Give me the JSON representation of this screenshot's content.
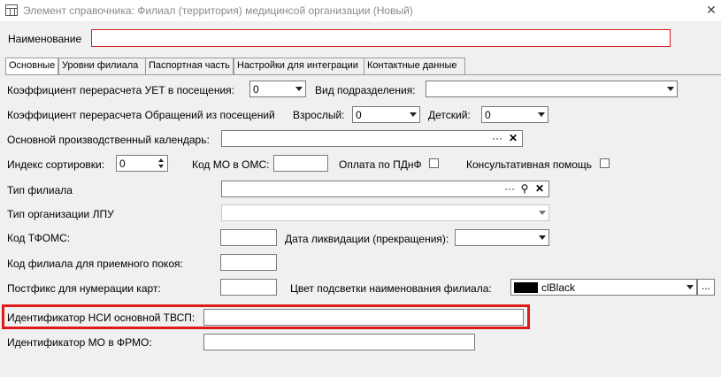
{
  "window": {
    "title": "Элемент справочника: Филиал (территория) медицинсой организации (Новый)",
    "close_glyph": "✕"
  },
  "name_field": {
    "label": "Наименование",
    "value": ""
  },
  "tabs": [
    {
      "label": "Основные",
      "active": true
    },
    {
      "label": "Уровни филиала",
      "active": false
    },
    {
      "label": "Паспортная часть",
      "active": false
    },
    {
      "label": "Настройки для интеграции",
      "active": false
    },
    {
      "label": "Контактные данные",
      "active": false
    }
  ],
  "form": {
    "uet_label": "Коэффициент перерасчета УЕТ в посещения:",
    "uet_value": "0",
    "division_label": "Вид подразделения:",
    "division_value": "",
    "appeals_label": "Коэффициент перерасчета Обращений из посещений",
    "adult_label": "Взрослый:",
    "adult_value": "0",
    "child_label": "Детский:",
    "child_value": "0",
    "calendar_label": "Основной производственный календарь:",
    "calendar_value": "",
    "sort_label": "Индекс сортировки:",
    "sort_value": "0",
    "mo_oms_label": "Код МО в ОМС:",
    "mo_oms_value": "",
    "pdnf_label": "Оплата по ПДнФ",
    "consult_label": "Консультативная помощь",
    "branch_type_label": "Тип филиала",
    "branch_type_value": "",
    "lpu_type_label": "Тип организации ЛПУ",
    "lpu_type_value": "",
    "tfoms_label": "Код ТФОМС:",
    "tfoms_value": "",
    "liquidation_label": "Дата ликвидации (прекращения):",
    "liquidation_value": "",
    "reception_label": "Код филиала для приемного покоя:",
    "reception_value": "",
    "postfix_label": "Постфикс для нумерации карт:",
    "postfix_value": "",
    "color_label": "Цвет подсветки наименования филиала:",
    "color_value": "clBlack",
    "color_swatch": "#000000",
    "nsi_label": "Идентификатор НСИ основной ТВСП:",
    "nsi_value": "",
    "frmo_label": "Идентификатор МО в ФРМО:",
    "frmo_value": ""
  },
  "icons": {
    "ellipsis": "···",
    "clear": "✕",
    "search": "⚲",
    "dots_button": "..."
  },
  "colors": {
    "highlight": "#e0191a",
    "required_border": "#d21f1f"
  }
}
